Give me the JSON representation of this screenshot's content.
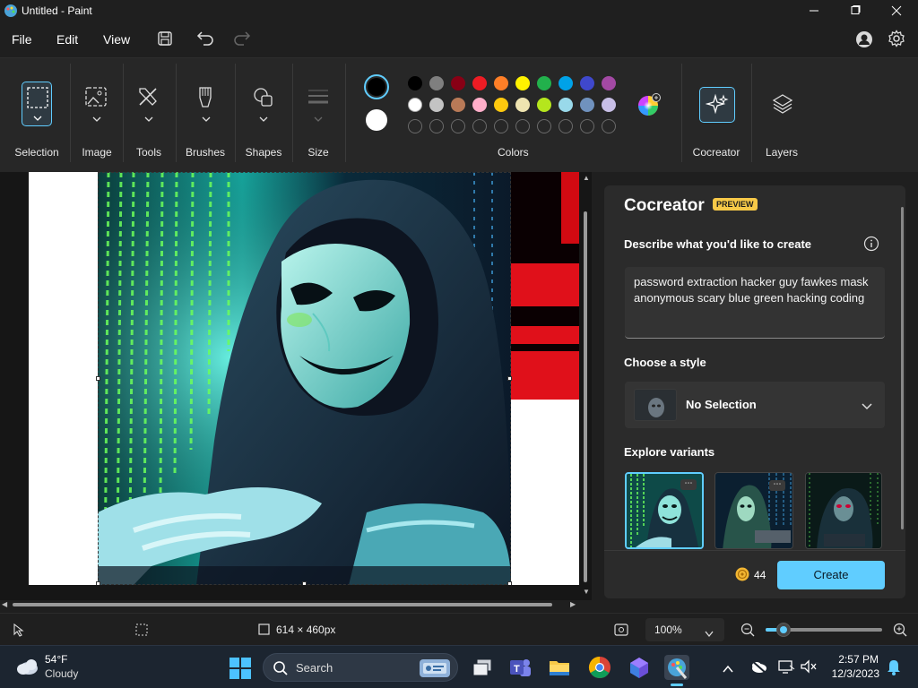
{
  "window": {
    "title": "Untitled - Paint"
  },
  "menu": {
    "file": "File",
    "edit": "Edit",
    "view": "View"
  },
  "ribbon": {
    "selection": "Selection",
    "image": "Image",
    "tools": "Tools",
    "brushes": "Brushes",
    "shapes": "Shapes",
    "size": "Size",
    "colors": "Colors",
    "cocreator": "Cocreator",
    "layers": "Layers"
  },
  "palette": {
    "row1": [
      "#000000",
      "#7f7f7f",
      "#880015",
      "#ed1c24",
      "#ff7f27",
      "#fff200",
      "#22b14c",
      "#00a2e8",
      "#3f48cc",
      "#a349a4"
    ],
    "row2": [
      "#ffffff",
      "#c3c3c3",
      "#b97a57",
      "#ffaec9",
      "#ffc90e",
      "#efe4b0",
      "#b5e61d",
      "#99d9ea",
      "#7092be",
      "#c8bfe7"
    ],
    "primary": "#000000",
    "secondary": "#ffffff"
  },
  "cocreator": {
    "title": "Cocreator",
    "badge": "PREVIEW",
    "describe_label": "Describe what you'd like to create",
    "prompt_text": "password extraction hacker guy fawkes mask anonymous scary blue green hacking coding",
    "style_label": "Choose a style",
    "style_value": "No Selection",
    "variants_label": "Explore variants",
    "credits": "44",
    "create_button": "Create"
  },
  "status": {
    "dimensions": "614 × 460px",
    "zoom": "100%",
    "zoom_slider_value": 0.15
  },
  "taskbar": {
    "temperature": "54°F",
    "condition": "Cloudy",
    "search": "Search",
    "time": "2:57 PM",
    "date": "12/3/2023"
  },
  "colors": {
    "accent": "#60cdff",
    "badge": "#f7c948"
  }
}
